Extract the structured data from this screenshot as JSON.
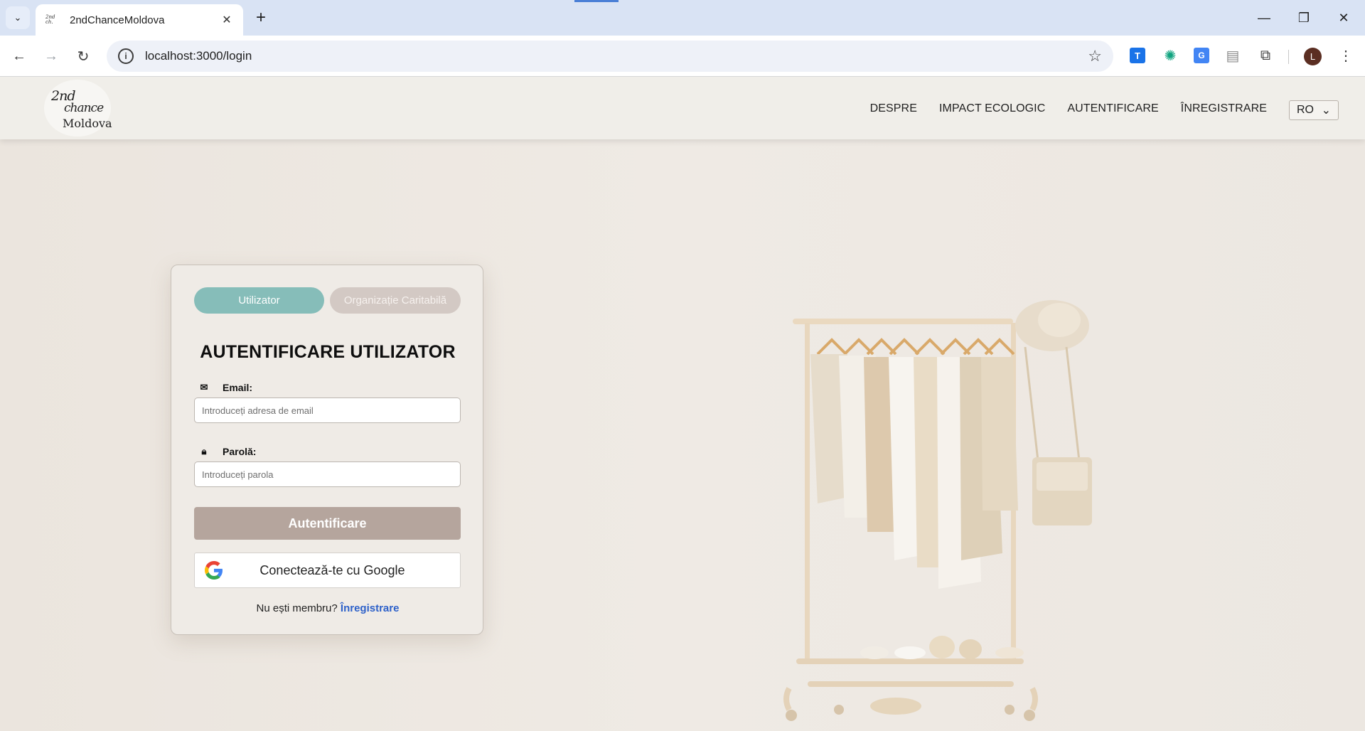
{
  "browser": {
    "tab_title": "2ndChanceMoldova",
    "url": "localhost:3000/login",
    "profile_initial": "L"
  },
  "site": {
    "logo": {
      "line1": "2nd",
      "line2": "chance",
      "line3": "Moldova"
    },
    "nav": [
      {
        "label": "DESPRE"
      },
      {
        "label": "IMPACT ECOLOGIC"
      },
      {
        "label": "AUTENTIFICARE"
      },
      {
        "label": "ÎNREGISTRARE"
      }
    ],
    "language": "RO"
  },
  "login": {
    "tabs": {
      "user": "Utilizator",
      "charity": "Organizație Caritabilă"
    },
    "active_tab": "user",
    "title": "AUTENTIFICARE UTILIZATOR",
    "email_label": "Email:",
    "email_placeholder": "Introduceți adresa de email",
    "email_value": "",
    "password_label": "Parolă:",
    "password_placeholder": "Introduceți parola",
    "password_value": "",
    "submit_label": "Autentificare",
    "google_label": "Conectează-te cu Google",
    "signup_prompt": "Nu ești membru?",
    "signup_link": "Înregistrare"
  },
  "colors": {
    "active_tab": "#86bdb9",
    "inactive_tab": "#d3c9c4",
    "submit_button": "#b5a59d",
    "link": "#2e61c9",
    "page_background": "#ede8e2"
  }
}
